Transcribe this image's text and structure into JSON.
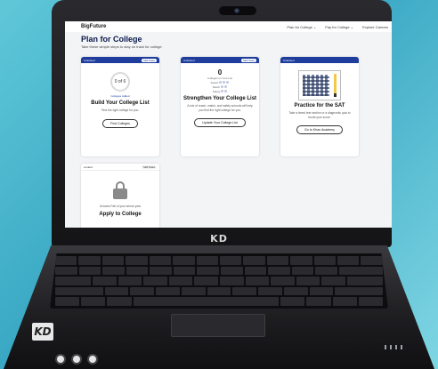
{
  "laptop": {
    "brand": "KD",
    "badge": "KD"
  },
  "site": {
    "logo": "BigFuture",
    "nav": [
      "Plan for College ⌄",
      "Pay for College ⌄",
      "Explore Careers"
    ]
  },
  "page": {
    "title": "Plan for College",
    "subtitle": "Take these simple steps to stay on track for college."
  },
  "cards": [
    {
      "status": "Unlocked",
      "pill": "Skill Stats",
      "ring": "0 of 6",
      "ring_caption": "Colleges Added",
      "title": "Build Your College List",
      "text": "Find the right college for you.",
      "button": "Find Colleges"
    },
    {
      "status": "Unlocked",
      "pill": "Skill Stats",
      "count": "0",
      "count_caption": "Colleges on Your List",
      "rows": [
        "Reach",
        "Match",
        "Safety"
      ],
      "title": "Strengthen Your College List",
      "text": "A mix of reach, match, and safety schools will help you find the right college for you.",
      "button": "Update Your College List"
    },
    {
      "status": "Unlocked",
      "title": "Practice for the SAT",
      "text": "Take a timed test section or a diagnostic quiz to boost your score.",
      "button": "Go to Khan Academy"
    },
    {
      "status": "Locked",
      "pill": "Skill Stats",
      "text": "Unlocks Fall of your senior year",
      "title": "Apply to College"
    }
  ],
  "colors": {
    "primary": "#1e3d9c",
    "heading": "#0b1a4a"
  }
}
